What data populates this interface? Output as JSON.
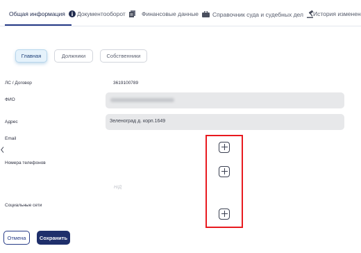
{
  "tabs": [
    {
      "label": "Общая информация",
      "icon": "info-icon",
      "active": true
    },
    {
      "label": "Документооборот",
      "icon": "documents-icon"
    },
    {
      "label": "Финансовые данные",
      "icon": "briefcase-icon"
    },
    {
      "label": "Справочник суда и судебных дел",
      "icon": "gavel-icon"
    },
    {
      "label": "История изменен"
    }
  ],
  "subtabs": [
    {
      "label": "Главная",
      "active": true
    },
    {
      "label": "Должники"
    },
    {
      "label": "Собственники"
    }
  ],
  "form": {
    "account_label": "ЛС / Договор",
    "account_value": "3619100789",
    "fio_label": "ФИО",
    "address_label": "Адрес",
    "address_value": "Зеленоград д. корп.1649",
    "email_label": "Email",
    "phones_label": "Номера телефонов",
    "phones_empty": "Н/Д",
    "social_label": "Социальные сети"
  },
  "actions": {
    "cancel_label": "Отмена",
    "save_label": "Сохранить"
  },
  "colors": {
    "accent": "#253a86",
    "highlight": "#e8191e"
  }
}
